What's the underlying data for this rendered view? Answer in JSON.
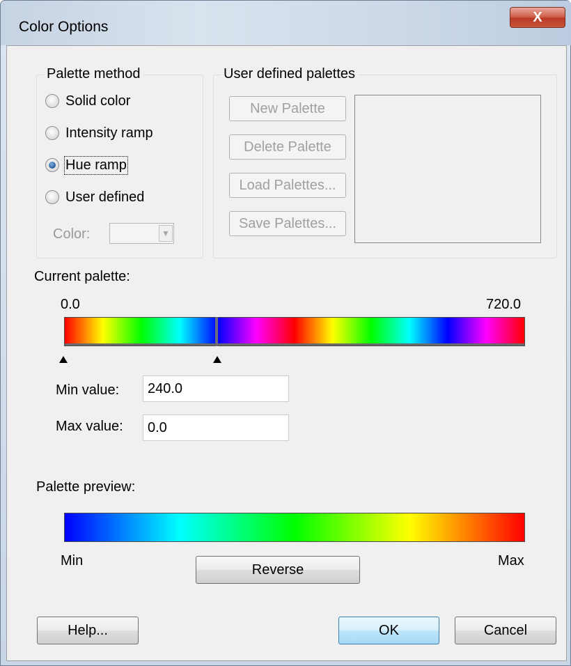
{
  "window": {
    "title": "Color Options",
    "close_glyph": "X"
  },
  "palette_method": {
    "group_label": "Palette method",
    "options": [
      {
        "label": "Solid color",
        "checked": false
      },
      {
        "label": "Intensity ramp",
        "checked": false
      },
      {
        "label": "Hue ramp",
        "checked": true
      },
      {
        "label": "User defined",
        "checked": false
      }
    ],
    "color_label": "Color:"
  },
  "user_palettes": {
    "group_label": "User defined palettes",
    "buttons": [
      "New Palette",
      "Delete Palette",
      "Load Palettes...",
      "Save Palettes..."
    ]
  },
  "current_palette": {
    "label": "Current palette:",
    "range_min": "0.0",
    "range_max": "720.0",
    "marker_glyph": "▲",
    "min_value_label": "Min value:",
    "min_value": "240.0",
    "max_value_label": "Max value:",
    "max_value": "0.0"
  },
  "preview": {
    "label": "Palette preview:",
    "min_label": "Min",
    "max_label": "Max",
    "reverse_button": "Reverse"
  },
  "footer": {
    "help": "Help...",
    "ok": "OK",
    "cancel": "Cancel"
  },
  "colors": {
    "dialog_bg": "#f0f0f0",
    "title_bg": "#d9e3ee",
    "close_red": "#c8553b",
    "default_button_border": "#3c7fb1"
  }
}
